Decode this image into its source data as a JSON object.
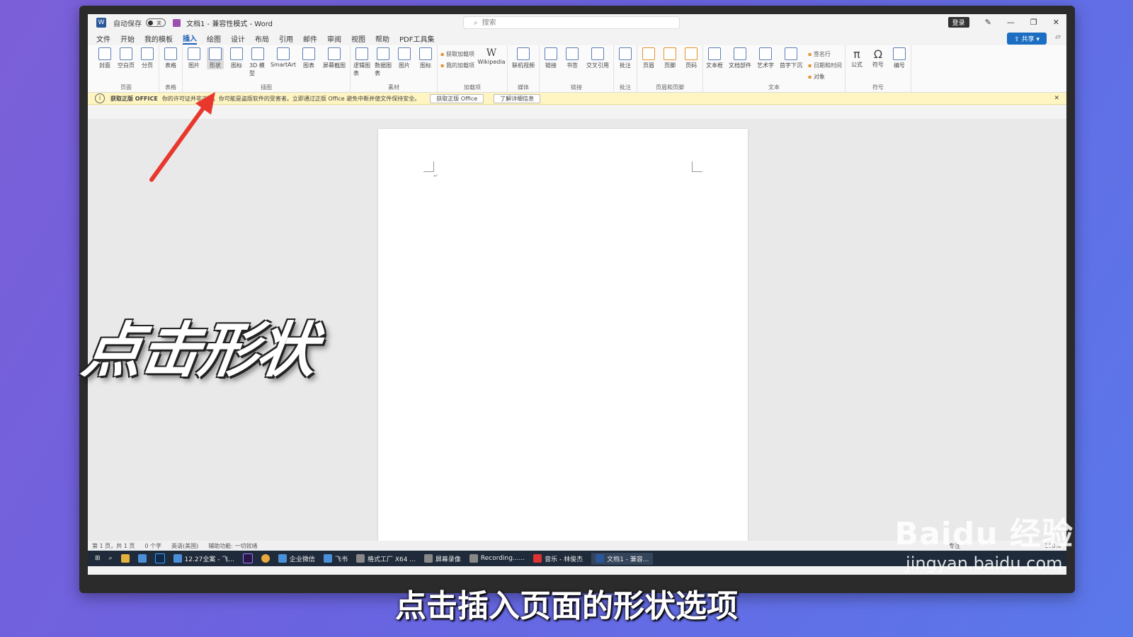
{
  "titlebar": {
    "autosave": "自动保存",
    "toggle": "关",
    "doc_title": "文档1 - 兼容性模式 - Word",
    "search_placeholder": "搜索",
    "login": "登录"
  },
  "menu": {
    "tabs": [
      "文件",
      "开始",
      "我的模板",
      "插入",
      "绘图",
      "设计",
      "布局",
      "引用",
      "邮件",
      "审阅",
      "视图",
      "帮助",
      "PDF工具集"
    ],
    "active": "插入",
    "share": "共享"
  },
  "ribbon": {
    "groups": [
      {
        "label": "页面",
        "items": [
          "封面",
          "空白页",
          "分页"
        ]
      },
      {
        "label": "表格",
        "items": [
          "表格"
        ]
      },
      {
        "label": "插图",
        "items": [
          "图片",
          "形状",
          "图标",
          "3D 模型",
          "SmartArt",
          "图表",
          "屏幕截图"
        ]
      },
      {
        "label": "素材",
        "items": [
          "逻辑图表",
          "数据图表",
          "图片",
          "图标"
        ]
      },
      {
        "label": "加载项",
        "small": [
          "获取加载项",
          "我的加载项"
        ],
        "items": [
          "Wikipedia"
        ]
      },
      {
        "label": "媒体",
        "items": [
          "联机视频"
        ]
      },
      {
        "label": "链接",
        "items": [
          "链接",
          "书签",
          "交叉引用"
        ]
      },
      {
        "label": "批注",
        "items": [
          "批注"
        ]
      },
      {
        "label": "页眉和页脚",
        "items": [
          "页眉",
          "页脚",
          "页码"
        ]
      },
      {
        "label": "文本",
        "items": [
          "文本框",
          "文档部件",
          "艺术字",
          "首字下沉"
        ],
        "small": [
          "签名行",
          "日期和时间",
          "对象"
        ]
      },
      {
        "label": "符号",
        "items": [
          "公式",
          "符号",
          "编号"
        ]
      }
    ]
  },
  "notice": {
    "title": "获取正版 OFFICE",
    "text": "你的许可证并非正版，你可能是盗版软件的受害者。立即通过正版 Office 避免中断并使文件保持安全。",
    "btn1": "获取正版 Office",
    "btn2": "了解详细信息"
  },
  "statusbar": {
    "page": "第 1 页，共 1 页",
    "words": "0 个字",
    "lang": "英语(美国)",
    "access": "辅助功能: 一切就绪",
    "focus": "专注",
    "zoom": "100%"
  },
  "taskbar": {
    "items": [
      "12.27全案 - 飞...",
      "企业微信",
      "飞书",
      "格式工厂 X64 ...",
      "屏幕录像",
      "Recording......",
      "音乐 - 林俊杰",
      "文档1 - 兼容..."
    ]
  },
  "overlay": {
    "big_caption": "点击形状",
    "subtitle": "点击插入页面的形状选项",
    "watermark_main": "Baidu 经验",
    "watermark_url": "jingyan.baidu.com"
  },
  "colors": {
    "accent": "#1b5fb8",
    "arrow": "#e8372c",
    "notice_bg": "#fff5c2"
  }
}
